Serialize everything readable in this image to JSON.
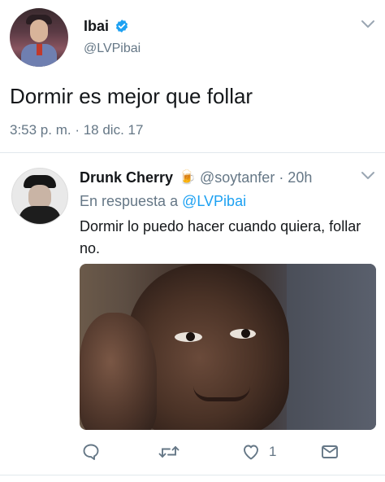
{
  "tweet": {
    "display_name": "Ibai",
    "handle": "@LVPibai",
    "text": "Dormir es mejor que follar",
    "timestamp": "3:53 p. m. · 18 dic. 17",
    "verified": true
  },
  "reply": {
    "display_name": "Drunk Cherry",
    "emoji": "🍺",
    "handle_time": "@soytanfer · 20h",
    "reply_prefix": "En respuesta a",
    "reply_mention": "@LVPibai",
    "text": "Dormir lo puedo hacer cuando quiera, follar no.",
    "actions": {
      "like_count": "1"
    }
  },
  "colors": {
    "verified_blue": "#1da1f2",
    "link_blue": "#1da1f2",
    "secondary_text": "#657786",
    "divider": "#e1e8ed"
  },
  "icons": [
    "verified-badge-icon",
    "chevron-down-icon",
    "beer-icon",
    "reply-icon",
    "retweet-icon",
    "like-heart-icon",
    "direct-message-icon"
  ]
}
